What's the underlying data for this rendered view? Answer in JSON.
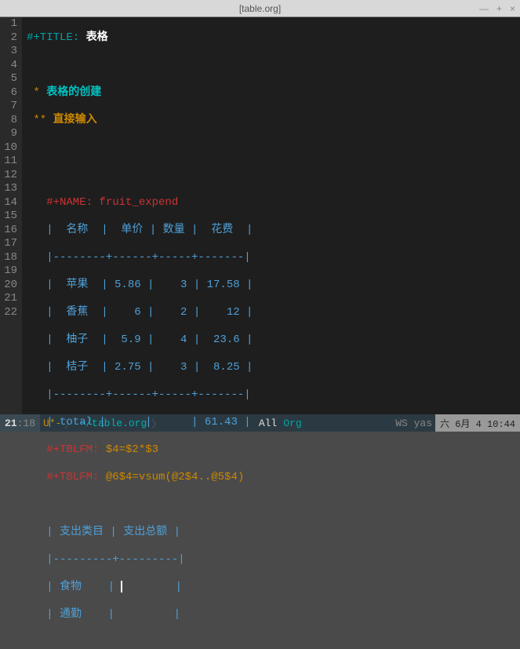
{
  "titlebar": {
    "text": "[table.org]",
    "min": "—",
    "max": "+",
    "close": "×"
  },
  "lines": {
    "l1_kw": "#+TITLE: ",
    "l1_val": "表格",
    "l3_star": " * ",
    "l3_text": "表格的创建",
    "l4_star": " ** ",
    "l4_text": "直接输入",
    "l7": "   #+NAME: fruit_expend",
    "l8": "   |  名称  |  单价 | 数量 |  花费  |",
    "l9": "   |--------+------+-----+-------|",
    "l10": "   |  苹果  | 5.86 |    3 | 17.58 |",
    "l11": "   |  香蕉  |    6 |    2 |    12 |",
    "l12": "   |  柚子  |  5.9 |    4 |  23.6 |",
    "l13": "   |  桔子  | 2.75 |    3 |  8.25 |",
    "l14": "   |--------+------+-----+-------|",
    "l15": "   | total |      |      | 61.43 |",
    "l16_kw": "   #+TBLFM: ",
    "l16_f": "$4=$2*$3",
    "l17_kw": "   #+TBLFM: ",
    "l17_f": "@6$4=vsum(@2$4..@5$4)",
    "l19": "   | 支出类目 | 支出总额 |",
    "l20": "   |---------+---------|",
    "l21a": "   | 食物    | ",
    "l21b": "        |",
    "l22": "   | 通勤    |         |"
  },
  "gutter": [
    "1",
    "2",
    "3",
    "4",
    "5",
    "6",
    "7",
    "8",
    "9",
    "10",
    "11",
    "12",
    "13",
    "14",
    "15",
    "16",
    "17",
    "18",
    "19",
    "20",
    "21",
    "22"
  ],
  "modeline": {
    "row": "21",
    "col": ":18",
    "modified": " U*-",
    "file": "~/table.org",
    "all": "All",
    "mode": " Org",
    "minor": "WS yas",
    "time": "六 6月   4 10:44"
  }
}
